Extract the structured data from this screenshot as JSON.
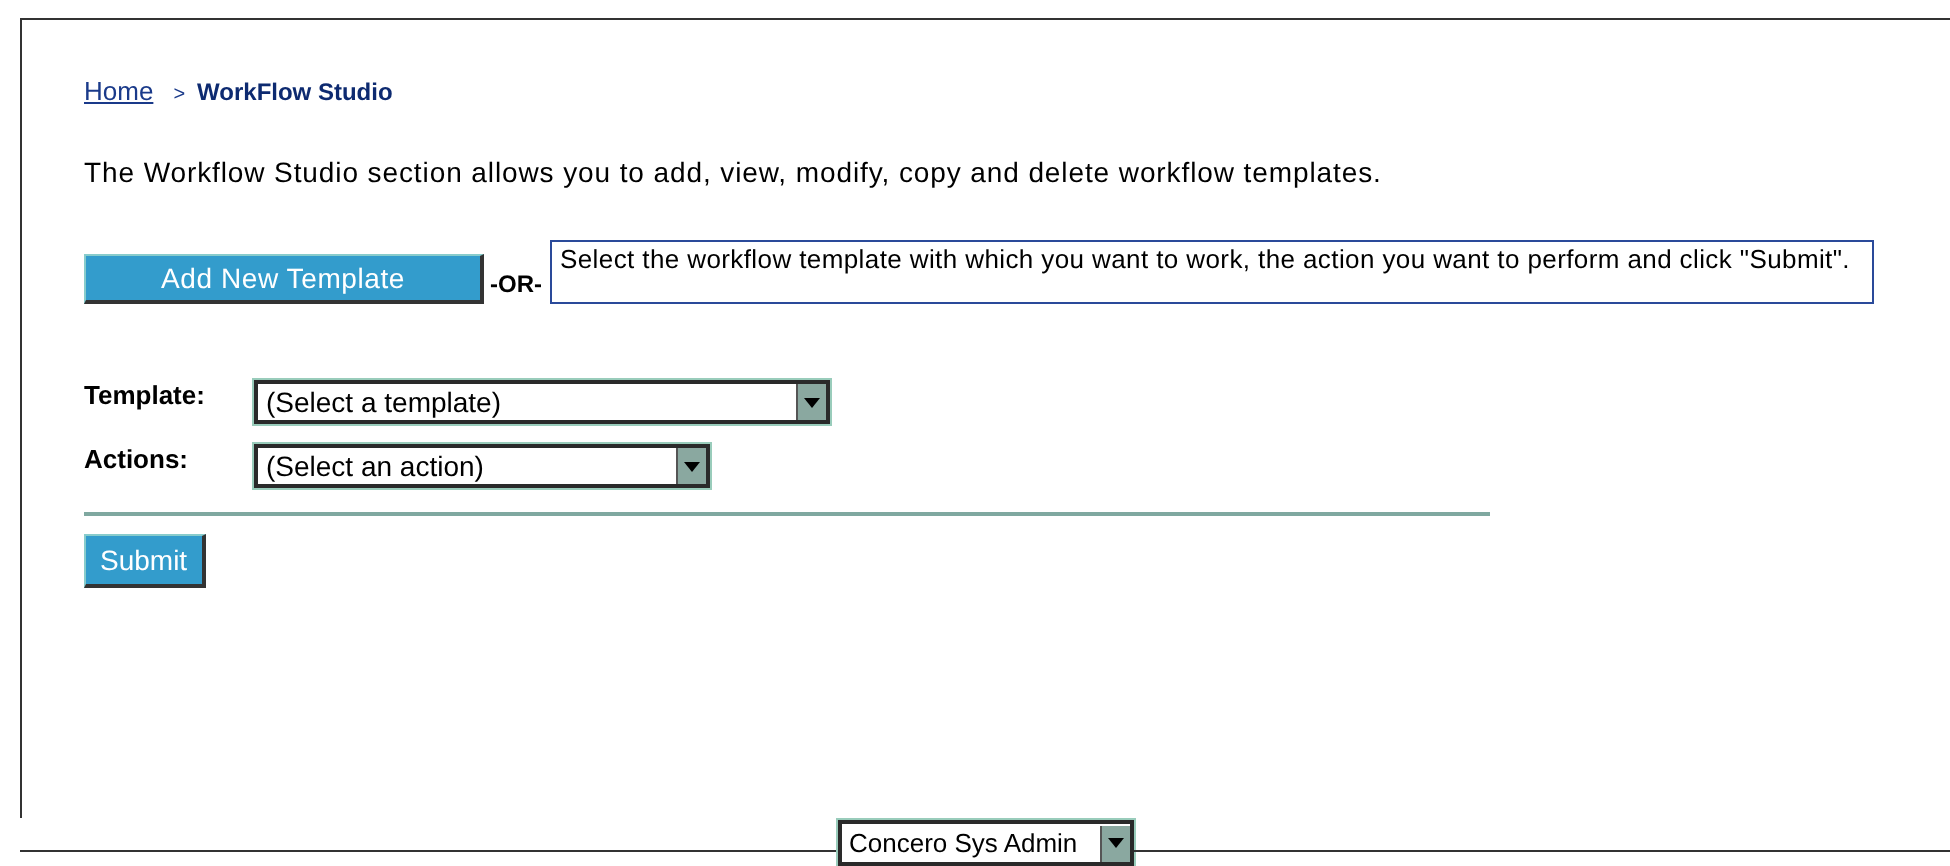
{
  "breadcrumb": {
    "home": "Home",
    "separator": ">",
    "current": "WorkFlow Studio"
  },
  "description": "The Workflow Studio section allows you to add, view, modify, copy and delete workflow templates.",
  "add_button": "Add New Template",
  "or_label": "-OR-",
  "instructions": "Select the workflow template with which you want to work, the action you want to perform and click \"Submit\".",
  "fields": [
    {
      "label": "Template:",
      "value": "(Select a template)"
    },
    {
      "label": "Actions:",
      "value": "(Select an action)"
    }
  ],
  "submit_button": "Submit",
  "footer": {
    "user_select": "Concero Sys Admin"
  }
}
